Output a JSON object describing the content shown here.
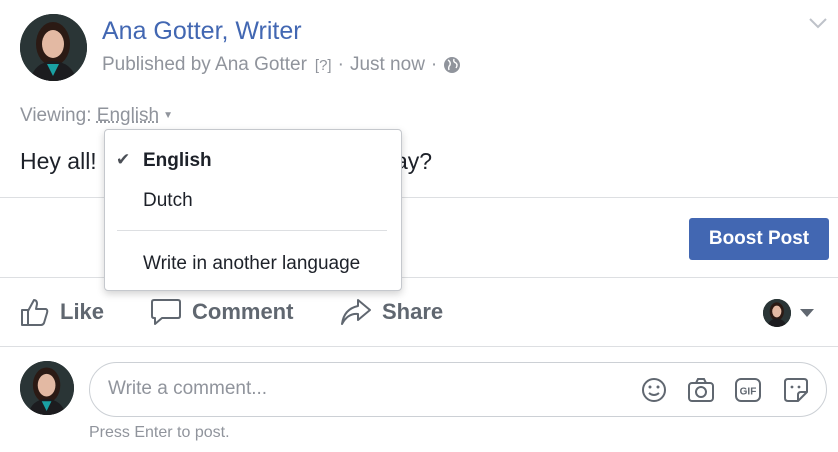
{
  "post": {
    "author_name": "Ana Gotter, Writer",
    "published_by": "Published by Ana Gotter",
    "help_marker": "[?]",
    "separator": "·",
    "time": "Just now",
    "viewing_label": "Viewing:",
    "viewing_language": "English",
    "text_left": "Hey all!",
    "text_right": "ay?"
  },
  "boost": {
    "label": "Boost Post"
  },
  "actions": {
    "like": "Like",
    "comment": "Comment",
    "share": "Share"
  },
  "language_menu": {
    "items": [
      {
        "label": "English",
        "selected": true
      },
      {
        "label": "Dutch",
        "selected": false
      }
    ],
    "write_other": "Write in another language"
  },
  "comment_box": {
    "placeholder": "Write a comment...",
    "hint": "Press Enter to post.",
    "icons": [
      "smiley-icon",
      "camera-icon",
      "gif-icon",
      "sticker-icon"
    ]
  },
  "colors": {
    "brand": "#4267b2",
    "muted_text": "#90949c",
    "action_text": "#606770"
  }
}
